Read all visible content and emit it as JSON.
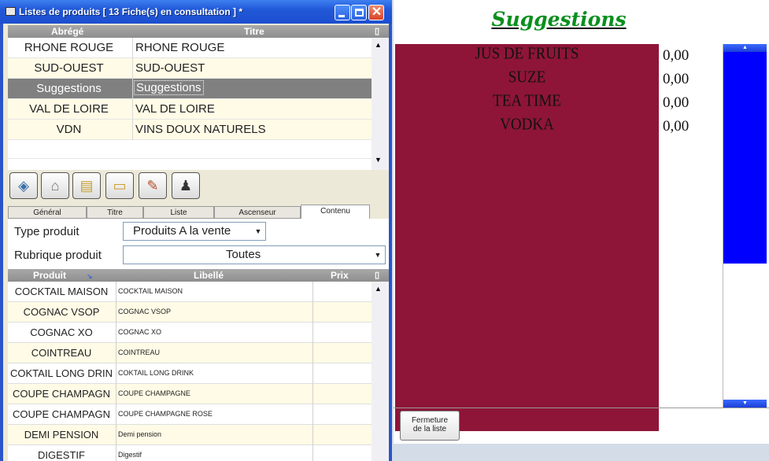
{
  "window": {
    "title": "Listes de produits  [ 13 Fiche(s) en consultation ] *",
    "minimize_icon": "minimize-icon",
    "maximize_icon": "maximize-icon",
    "close_icon": "close-icon",
    "close_glyph": "✕"
  },
  "top_grid": {
    "headers": {
      "abrege": "Abrégé",
      "titre": "Titre"
    },
    "rows": [
      {
        "abrege": "RHONE ROUGE",
        "titre": "RHONE ROUGE"
      },
      {
        "abrege": "SUD-OUEST",
        "titre": "SUD-OUEST"
      },
      {
        "abrege": "Suggestions",
        "titre": "Suggestions"
      },
      {
        "abrege": "VAL DE LOIRE",
        "titre": "VAL DE LOIRE"
      },
      {
        "abrege": "VDN",
        "titre": "VINS DOUX NATURELS"
      }
    ],
    "selected_index": 2
  },
  "toolbar": {
    "buttons": [
      "export-icon",
      "delete-icon",
      "new-record-icon",
      "copy-record-icon",
      "edit-icon",
      "presenter-icon"
    ]
  },
  "tabs": {
    "general": "Général",
    "titre": "Titre",
    "liste": "Liste",
    "ascenseur": "Ascenseur",
    "contenu": "Contenu",
    "active": "Contenu"
  },
  "form": {
    "type_produit_label": "Type produit",
    "type_produit_value": "Produits A la vente",
    "rubrique_label": "Rubrique produit",
    "rubrique_value": "Toutes"
  },
  "bottom_grid": {
    "headers": {
      "produit": "Produit",
      "libelle": "Libellé",
      "prix": "Prix"
    },
    "rows": [
      {
        "produit": "COCKTAIL MAISON",
        "libelle": "COCKTAIL MAISON"
      },
      {
        "produit": "COGNAC VSOP",
        "libelle": "COGNAC VSOP"
      },
      {
        "produit": "COGNAC XO",
        "libelle": "COGNAC XO"
      },
      {
        "produit": "COINTREAU",
        "libelle": "COINTREAU"
      },
      {
        "produit": "COKTAIL LONG DRIN",
        "libelle": "COKTAIL LONG DRINK"
      },
      {
        "produit": "COUPE CHAMPAGN",
        "libelle": "COUPE CHAMPAGNE"
      },
      {
        "produit": "COUPE CHAMPAGN",
        "libelle": "COUPE CHAMPAGNE ROSE"
      },
      {
        "produit": "DEMI PENSION",
        "libelle": "Demi pension"
      },
      {
        "produit": "DIGESTIF",
        "libelle": "Digestif"
      }
    ]
  },
  "suggestions": {
    "title": "Suggestions",
    "items": [
      {
        "name": "JUS DE FRUITS",
        "price": "0,00"
      },
      {
        "name": "SUZE",
        "price": "0,00"
      },
      {
        "name": "TEA TIME",
        "price": "0,00"
      },
      {
        "name": "VODKA",
        "price": "0,00"
      }
    ],
    "close_button_line1": "Fermeture",
    "close_button_line2": "de la liste"
  },
  "colors": {
    "panel_maroon": "#8e1538",
    "title_green": "#0a8f1e",
    "scroll_blue": "#0000ff",
    "selected_row": "#808080"
  }
}
